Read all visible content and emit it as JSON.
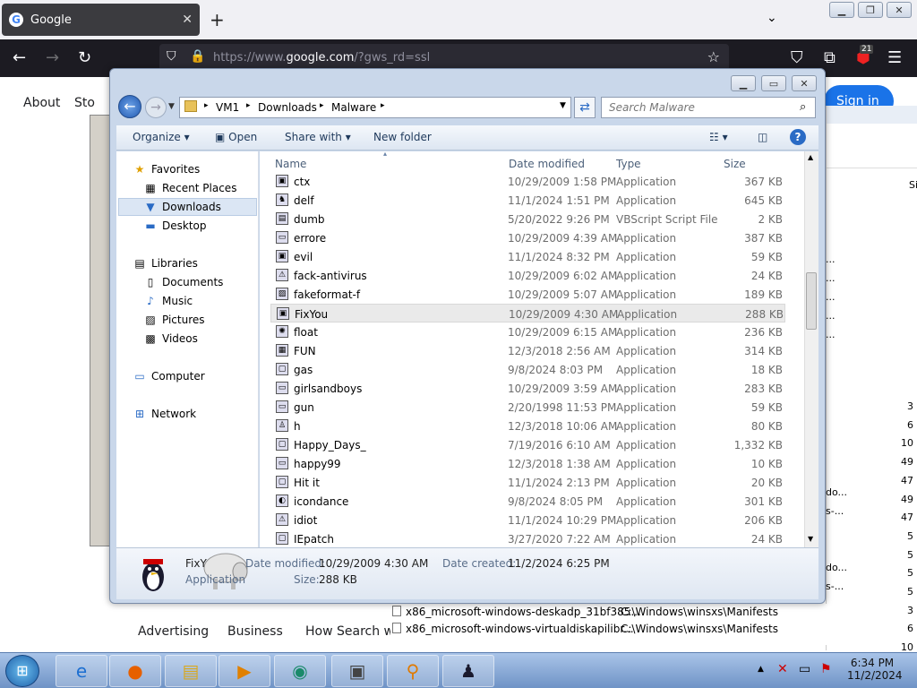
{
  "browser": {
    "tab_title": "Google",
    "url_prefix": "https://www.",
    "url_domain": "google.com",
    "url_suffix": "/?gws_rd=ssl",
    "extension_badge": "21"
  },
  "google": {
    "top_links": [
      "About",
      "Sto"
    ],
    "signin": "Sign in",
    "footer_links": [
      "Advertising",
      "Business",
      "How Search w"
    ]
  },
  "background_window": {
    "col_header": "Siz",
    "rows": [
      {
        "path": "x86_microsoft-windows-deskadp_31bf385...",
        "location": "C:\\Windows\\winsxs\\Manifests"
      },
      {
        "path": "x86_microsoft-windows-virtualdiskapilibr...",
        "location": "C:\\Windows\\winsxs\\Manifests"
      }
    ],
    "right_values": [
      "3",
      "6",
      "10",
      "49",
      "47",
      "49",
      "47",
      "5",
      "5",
      "5",
      "5",
      "3",
      "6",
      "10"
    ],
    "truncated": [
      "...",
      "...",
      "...",
      "...",
      "...",
      "do...",
      "s-...",
      "do...",
      "s-..."
    ]
  },
  "explorer": {
    "breadcrumb": [
      "VM1",
      "Downloads",
      "Malware"
    ],
    "search_placeholder": "Search Malware",
    "toolbar": {
      "organize": "Organize",
      "open": "Open",
      "share": "Share with",
      "new_folder": "New folder"
    },
    "nav": {
      "favorites": "Favorites",
      "favorites_items": [
        "Recent Places",
        "Downloads",
        "Desktop"
      ],
      "libraries": "Libraries",
      "libraries_items": [
        "Documents",
        "Music",
        "Pictures",
        "Videos"
      ],
      "computer": "Computer",
      "network": "Network"
    },
    "columns": {
      "name": "Name",
      "date": "Date modified",
      "type": "Type",
      "size": "Size"
    },
    "files": [
      {
        "name": "ctx",
        "date": "10/29/2009 1:58 PM",
        "type": "Application",
        "size": "367 KB"
      },
      {
        "name": "delf",
        "date": "11/1/2024 1:51 PM",
        "type": "Application",
        "size": "645 KB"
      },
      {
        "name": "dumb",
        "date": "5/20/2022 9:26 PM",
        "type": "VBScript Script File",
        "size": "2 KB"
      },
      {
        "name": "errore",
        "date": "10/29/2009 4:39 AM",
        "type": "Application",
        "size": "387 KB"
      },
      {
        "name": "evil",
        "date": "11/1/2024 8:32 PM",
        "type": "Application",
        "size": "59 KB"
      },
      {
        "name": "fack-antivirus",
        "date": "10/29/2009 6:02 AM",
        "type": "Application",
        "size": "24 KB"
      },
      {
        "name": "fakeformat-f",
        "date": "10/29/2009 5:07 AM",
        "type": "Application",
        "size": "189 KB"
      },
      {
        "name": "FixYou",
        "date": "10/29/2009 4:30 AM",
        "type": "Application",
        "size": "288 KB"
      },
      {
        "name": "float",
        "date": "10/29/2009 6:15 AM",
        "type": "Application",
        "size": "236 KB"
      },
      {
        "name": "FUN",
        "date": "12/3/2018 2:56 AM",
        "type": "Application",
        "size": "314 KB"
      },
      {
        "name": "gas",
        "date": "9/8/2024 8:03 PM",
        "type": "Application",
        "size": "18 KB"
      },
      {
        "name": "girlsandboys",
        "date": "10/29/2009 3:59 AM",
        "type": "Application",
        "size": "283 KB"
      },
      {
        "name": "gun",
        "date": "2/20/1998 11:53 PM",
        "type": "Application",
        "size": "59 KB"
      },
      {
        "name": "h",
        "date": "12/3/2018 10:06 AM",
        "type": "Application",
        "size": "80 KB"
      },
      {
        "name": "Happy_Days_",
        "date": "7/19/2016 6:10 AM",
        "type": "Application",
        "size": "1,332 KB"
      },
      {
        "name": "happy99",
        "date": "12/3/2018 1:38 AM",
        "type": "Application",
        "size": "10 KB"
      },
      {
        "name": "Hit it",
        "date": "11/1/2024 2:13 PM",
        "type": "Application",
        "size": "20 KB"
      },
      {
        "name": "icondance",
        "date": "9/8/2024 8:05 PM",
        "type": "Application",
        "size": "301 KB"
      },
      {
        "name": "idiot",
        "date": "11/1/2024 10:29 PM",
        "type": "Application",
        "size": "206 KB"
      },
      {
        "name": "IEpatch",
        "date": "3/27/2020 7:22 AM",
        "type": "Application",
        "size": "24 KB"
      }
    ],
    "selected_index": 7,
    "details": {
      "name": "FixY",
      "kind": "Application",
      "date_modified_label": "Date modified:",
      "date_modified": "10/29/2009 4:30 AM",
      "date_created_label": "Date created:",
      "date_created": "11/2/2024 6:25 PM",
      "size_label": "Size:",
      "size": "288 KB"
    }
  },
  "taskbar": {
    "time": "6:34 PM",
    "date": "11/2/2024"
  }
}
